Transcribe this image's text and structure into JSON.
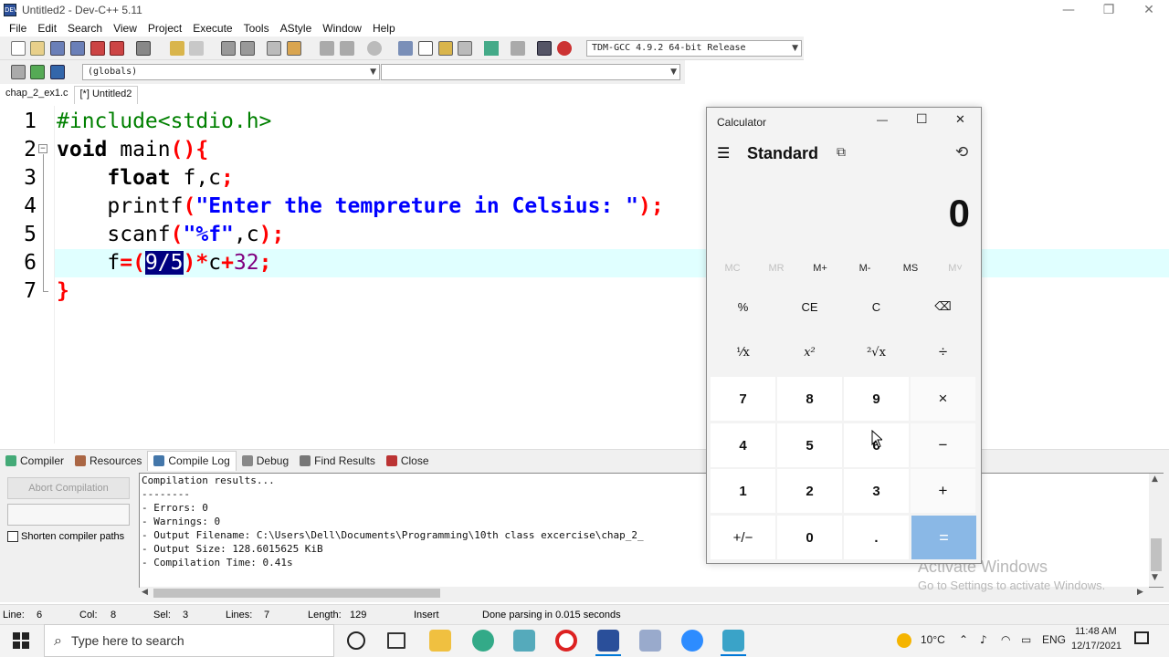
{
  "window": {
    "title": "Untitled2 - Dev-C++ 5.11",
    "icon_label": "DEV",
    "minimize_icon": "—",
    "maximize_icon": "❐",
    "close_icon": "✕"
  },
  "menu": [
    "File",
    "Edit",
    "Search",
    "View",
    "Project",
    "Execute",
    "Tools",
    "AStyle",
    "Window",
    "Help"
  ],
  "toolbar": {
    "compiler_select": "TDM-GCC 4.9.2 64-bit Release",
    "scope_select": "(globals)",
    "symbol_select": ""
  },
  "file_tabs": [
    {
      "label": "chap_2_ex1.c",
      "active": false
    },
    {
      "label": "[*] Untitled2",
      "active": true
    }
  ],
  "editor": {
    "line_numbers": [
      "1",
      "2",
      "3",
      "4",
      "5",
      "6",
      "7"
    ],
    "lines": {
      "l1_pp": "#include<stdio.h>",
      "l2_kw": "void",
      "l2_rest": " main",
      "l2_sym": "(){",
      "l3_kw": "float",
      "l3_rest": " f,c",
      "l3_sym": ";",
      "l4_a": "printf",
      "l4_sym1": "(",
      "l4_str": "\"Enter the tempreture in Celsius: \"",
      "l4_sym2": ");",
      "l5_a": "scanf",
      "l5_sym1": "(",
      "l5_str": "\"%f\"",
      "l5_b": ",c",
      "l5_sym2": ");",
      "l6_a": "f",
      "l6_sym1": "=(",
      "l6_sel": "9/5",
      "l6_sym2": ")*",
      "l6_b": "c",
      "l6_sym3": "+",
      "l6_num": "32",
      "l6_sym4": ";",
      "l7_sym": "}"
    },
    "fold_marker": "−",
    "current_line_color": "#e0ffff"
  },
  "bottom_tabs": [
    {
      "label": "Compiler",
      "icon": "compiler-icon",
      "color": "#4a7"
    },
    {
      "label": "Resources",
      "icon": "resources-icon",
      "color": "#a64"
    },
    {
      "label": "Compile Log",
      "icon": "compile-log-icon",
      "color": "#47a"
    },
    {
      "label": "Debug",
      "icon": "debug-icon",
      "color": "#888"
    },
    {
      "label": "Find Results",
      "icon": "find-results-icon",
      "color": "#777"
    },
    {
      "label": "Close",
      "icon": "close-panel-icon",
      "color": "#b33"
    }
  ],
  "compile_panel": {
    "abort_label": "Abort Compilation",
    "shorten_label": "Shorten compiler paths",
    "log": [
      "Compilation results...",
      "--------",
      "- Errors: 0",
      "- Warnings: 0",
      "- Output Filename: C:\\Users\\Dell\\Documents\\Programming\\10th class excercise\\chap_2_",
      "- Output Size: 128.6015625 KiB",
      "- Compilation Time: 0.41s"
    ]
  },
  "watermark": {
    "line1": "Activate Windows",
    "line2": "Go to Settings to activate Windows."
  },
  "status": {
    "line_label": "Line:",
    "line_val": "6",
    "col_label": "Col:",
    "col_val": "8",
    "sel_label": "Sel:",
    "sel_val": "3",
    "lines_label": "Lines:",
    "lines_val": "7",
    "length_label": "Length:",
    "length_val": "129",
    "mode": "Insert",
    "message": "Done parsing in 0.015 seconds"
  },
  "calculator": {
    "title": "Calculator",
    "mode": "Standard",
    "display": "0",
    "minimize_icon": "—",
    "maximize_icon": "☐",
    "close_icon": "✕",
    "menu_icon": "☰",
    "keep_on_top_icon": "⧉",
    "history_icon": "⟲",
    "memory": [
      {
        "label": "MC",
        "enabled": false
      },
      {
        "label": "MR",
        "enabled": false
      },
      {
        "label": "M+",
        "enabled": true
      },
      {
        "label": "M-",
        "enabled": true
      },
      {
        "label": "MS",
        "enabled": true
      },
      {
        "label": "M˅",
        "enabled": false
      }
    ],
    "keys": [
      [
        "%",
        "CE",
        "C",
        "⌫"
      ],
      [
        "¹⁄x",
        "x²",
        "²√x",
        "÷"
      ],
      [
        "7",
        "8",
        "9",
        "×"
      ],
      [
        "4",
        "5",
        "6",
        "−"
      ],
      [
        "1",
        "2",
        "3",
        "+"
      ],
      [
        "+/−",
        "0",
        ".",
        "="
      ]
    ],
    "accent_color": "#8ab8e6"
  },
  "taskbar": {
    "search_placeholder": "Type here to search",
    "weather": "10°C",
    "language": "ENG",
    "time": "11:48 AM",
    "date": "12/17/2021"
  }
}
